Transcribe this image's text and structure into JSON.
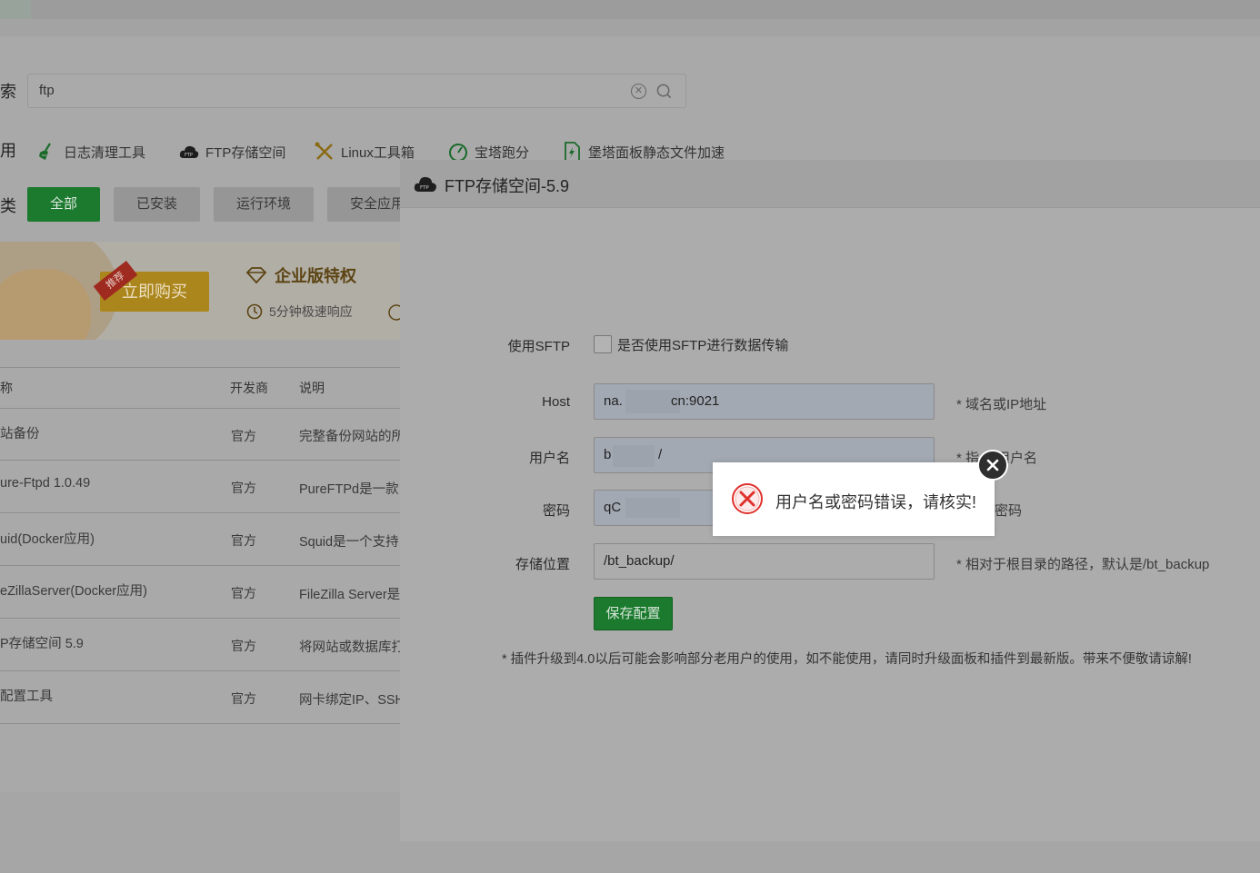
{
  "search": {
    "label_fragment": "索",
    "value": "ftp"
  },
  "quick_apps": {
    "row_label_fragment": "用",
    "items": [
      {
        "label": "日志清理工具",
        "icon": "broom-icon"
      },
      {
        "label": "FTP存储空间",
        "icon": "cloud-ftp-icon"
      },
      {
        "label": "Linux工具箱",
        "icon": "tools-icon"
      },
      {
        "label": "宝塔跑分",
        "icon": "speedometer-icon"
      },
      {
        "label": "堡塔面板静态文件加速",
        "icon": "bolt-file-icon"
      }
    ]
  },
  "categories": {
    "row_label_fragment": "类",
    "items": [
      "全部",
      "已安装",
      "运行环境",
      "安全应用"
    ],
    "active_index": 0
  },
  "banner": {
    "ribbon": "推荐",
    "buy_label": "立即购买",
    "title": "企业版特权",
    "subtitle": "5分钟极速响应"
  },
  "table": {
    "headers": {
      "name": "称",
      "vendor": "开发商",
      "desc": "说明"
    },
    "rows": [
      {
        "name": "站备份",
        "vendor": "官方",
        "desc": "完整备份网站的所"
      },
      {
        "name": "ure-Ftpd 1.0.49",
        "vendor": "官方",
        "desc": "PureFTPd是一款"
      },
      {
        "name": "uid(Docker应用)",
        "vendor": "官方",
        "desc": "Squid是一个支持"
      },
      {
        "name": "eZillaServer(Docker应用)",
        "vendor": "官方",
        "desc": "FileZilla Server是"
      },
      {
        "name": "P存储空间 5.9",
        "vendor": "官方",
        "desc": "将网站或数据库打"
      },
      {
        "name": "配置工具",
        "vendor": "官方",
        "desc": "网卡绑定IP、SSH"
      }
    ]
  },
  "modal": {
    "title": "FTP存储空间-5.9",
    "fields": {
      "sftp": {
        "label": "使用SFTP",
        "checkbox_text": "是否使用SFTP进行数据传输",
        "checked": false
      },
      "host": {
        "label": "Host",
        "value_start": "na.",
        "value_end": "cn:9021",
        "hint": "* 域名或IP地址"
      },
      "username": {
        "label": "用户名",
        "value_start": "b",
        "value_end": "/",
        "hint_start": "* 指",
        "hint_end": "用户名"
      },
      "password": {
        "label": "密码",
        "value_start": "qC",
        "hint_end": "密码"
      },
      "path": {
        "label": "存储位置",
        "value": "/bt_backup/",
        "hint": "* 相对于根目录的路径，默认是/bt_backup"
      }
    },
    "save_label": "保存配置",
    "note": "* 插件升级到4.0以后可能会影响部分老用户的使用，如不能使用，请同时升级面板和插件到最新版。带来不便敬请谅解!"
  },
  "toast": {
    "message": "用户名或密码错误，请核实!",
    "icon": "error-circle-icon",
    "close_icon": "close-icon"
  },
  "colors": {
    "primary_green": "#1b7a2e",
    "error_red": "#e0312c",
    "gold": "#ab861c"
  }
}
